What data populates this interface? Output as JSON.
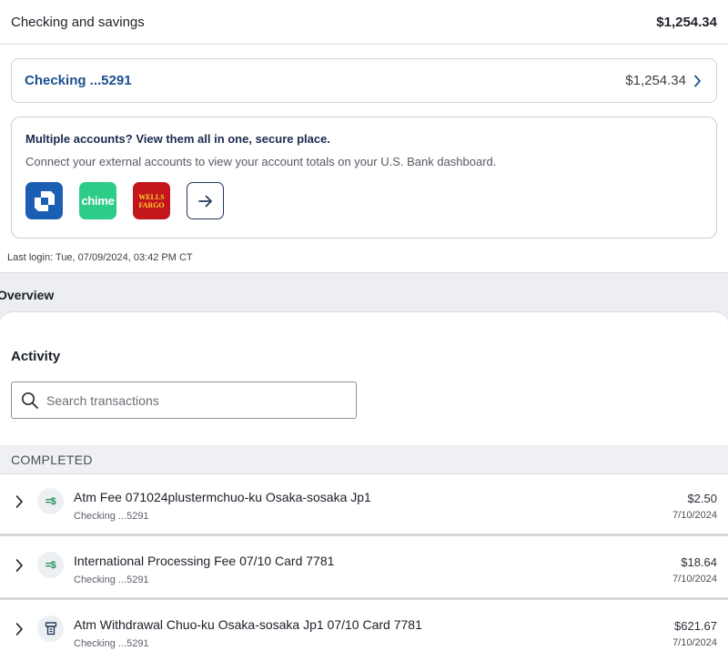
{
  "summary": {
    "title": "Checking and savings",
    "total": "$1,254.34"
  },
  "account": {
    "name": "Checking ...5291",
    "balance": "$1,254.34"
  },
  "promo": {
    "title": "Multiple accounts? View them all in one, secure place.",
    "text": "Connect your external accounts to view your account totals on your U.S. Bank dashboard.",
    "logos": {
      "chime": "chime",
      "wells_line1": "WELLS",
      "wells_line2": "FARGO"
    }
  },
  "last_login": "Last login: Tue, 07/09/2024, 03:42 PM CT",
  "overview_label": "Overview",
  "activity": {
    "title": "Activity",
    "search_placeholder": "Search transactions",
    "search_value": "",
    "section_label": "COMPLETED",
    "transactions": [
      {
        "description": "Atm Fee 071024plustermchuo-ku Osaka-sosaka Jp1",
        "account": "Checking ...5291",
        "amount": "$2.50",
        "date": "7/10/2024",
        "icon": "fee-icon"
      },
      {
        "description": "International Processing Fee 07/10 Card 7781",
        "account": "Checking ...5291",
        "amount": "$18.64",
        "date": "7/10/2024",
        "icon": "fee-icon"
      },
      {
        "description": "Atm Withdrawal Chuo-ku Osaka-sosaka Jp1 07/10 Card 7781",
        "account": "Checking ...5291",
        "amount": "$621.67",
        "date": "7/10/2024",
        "icon": "atm-icon"
      }
    ]
  },
  "colors": {
    "brand_blue": "#1d4f91",
    "chase": "#1a5fb4",
    "chime": "#2ecc89",
    "wells_fargo": "#c2161c",
    "fee_green": "#1f8f55"
  }
}
